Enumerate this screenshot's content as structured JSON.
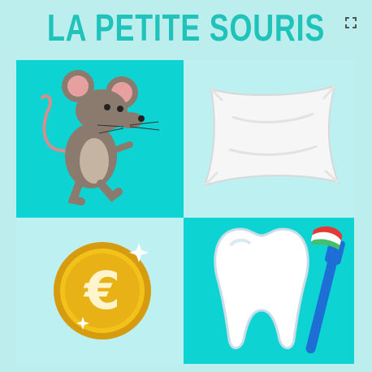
{
  "header": {
    "title": "LA PETITE SOURIS"
  },
  "controls": {
    "fullscreen_icon": "fullscreen-expand-icon"
  },
  "grid": {
    "cells": [
      {
        "icon": "mouse-icon"
      },
      {
        "icon": "pillow-icon"
      },
      {
        "icon": "euro-coin-icon"
      },
      {
        "icon": "tooth-toothbrush-icon"
      }
    ]
  },
  "colors": {
    "title": "#1fc3b9",
    "background": "#bdeeee",
    "cell_dark": "#0ed3d3",
    "cell_light": "#bdf0f0"
  }
}
